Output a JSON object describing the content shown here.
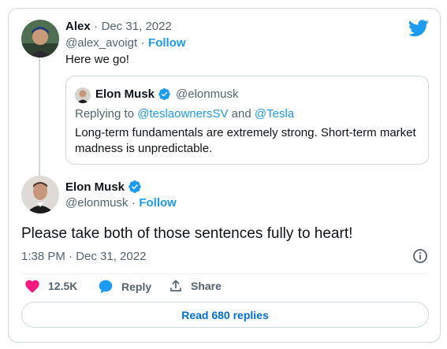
{
  "reply": {
    "author_name": "Alex",
    "separator": "·",
    "date": "Dec 31, 2022",
    "handle": "@alex_avoigt",
    "follow_label": "Follow",
    "text": "Here we go!"
  },
  "quote": {
    "author_name": "Elon Musk",
    "handle": "@elonmusk",
    "replying_label": "Replying to",
    "replying_to_1": "@teslaownersSV",
    "replying_and": "and",
    "replying_to_2": "@Tesla",
    "text_line1": "Long-term fundamentals are extremely strong. Short-term market",
    "text_line2": "madness is unpredictable."
  },
  "tweet": {
    "author_name": "Elon Musk",
    "handle": "@elonmusk",
    "follow_label": "Follow",
    "text": "Please take both of those sentences fully to heart!",
    "timestamp": "1:38 PM · Dec 31, 2022"
  },
  "actions": {
    "likes": "12.5K",
    "reply_label": "Reply",
    "share_label": "Share"
  },
  "read_replies_label": "Read 680 replies",
  "colors": {
    "accent": "#1d9bf0",
    "heart": "#f91880",
    "verified": "#1d9bf0",
    "muted": "#536471"
  },
  "icons": {
    "logo": "twitter-bird-icon",
    "verified": "verified-badge-icon",
    "info": "info-icon",
    "like": "heart-icon",
    "reply": "reply-bubble-icon",
    "share": "share-icon"
  }
}
